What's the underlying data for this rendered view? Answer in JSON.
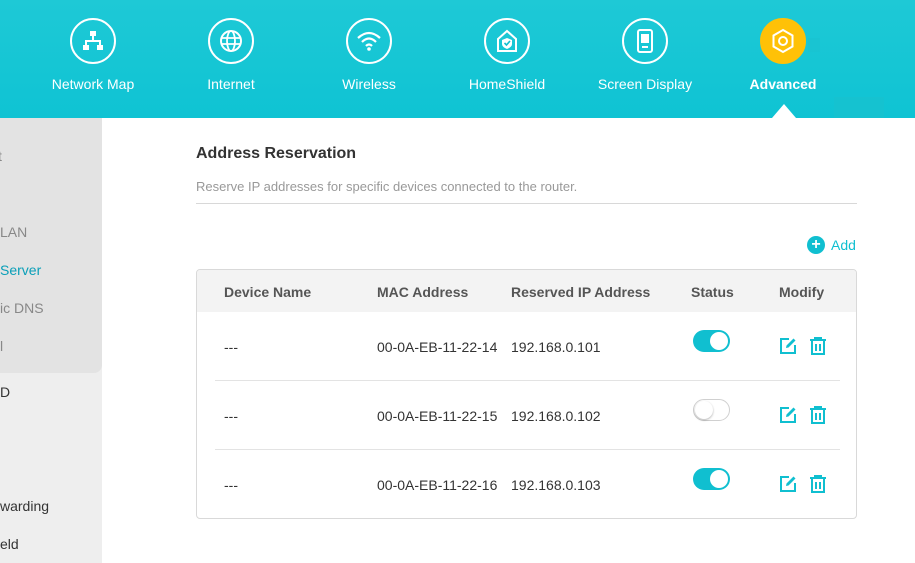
{
  "colors": {
    "accent": "#10bfd0",
    "active_nav": "#ffc107",
    "sidebar_active": "#0a9fb8"
  },
  "topnav": {
    "items": [
      {
        "label": "Network Map",
        "icon": "network-map-icon"
      },
      {
        "label": "Internet",
        "icon": "globe-icon"
      },
      {
        "label": "Wireless",
        "icon": "wifi-icon"
      },
      {
        "label": "HomeShield",
        "icon": "home-shield-icon"
      },
      {
        "label": "Screen Display",
        "icon": "screen-icon"
      },
      {
        "label": "Advanced",
        "icon": "gear-icon",
        "active": true
      }
    ]
  },
  "sidebar": {
    "items": [
      {
        "label": "t"
      },
      {
        "label": "LAN"
      },
      {
        "label": "Server",
        "active": true
      },
      {
        "label": "ic DNS"
      },
      {
        "label": "l"
      },
      {
        "label": "D"
      },
      {
        "label": "warding"
      },
      {
        "label": "eld"
      }
    ]
  },
  "main": {
    "title": "Address Reservation",
    "description": "Reserve IP addresses for specific devices connected to the router.",
    "add_label": "Add",
    "table": {
      "headers": [
        "Device Name",
        "MAC Address",
        "Reserved IP Address",
        "Status",
        "Modify"
      ],
      "rows": [
        {
          "device": "---",
          "mac": "00-0A-EB-11-22-14",
          "ip": "192.168.0.101",
          "status": true
        },
        {
          "device": "---",
          "mac": "00-0A-EB-11-22-15",
          "ip": "192.168.0.102",
          "status": false
        },
        {
          "device": "---",
          "mac": "00-0A-EB-11-22-16",
          "ip": "192.168.0.103",
          "status": true
        }
      ]
    }
  }
}
